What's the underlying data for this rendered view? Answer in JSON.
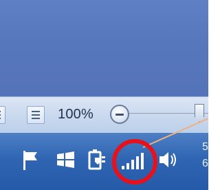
{
  "status_bar": {
    "zoom_level": "100%"
  },
  "taskbar": {
    "clock_fragment_top": "5",
    "clock_fragment_bottom": "6"
  },
  "colors": {
    "highlight_circle": "#e8101a",
    "callout_line": "#f0b080"
  },
  "icons": {
    "action_center": "flag-icon",
    "windows": "windows-logo-icon",
    "power": "power-plug-icon",
    "network": "signal-strength-icon",
    "volume": "speaker-icon"
  }
}
